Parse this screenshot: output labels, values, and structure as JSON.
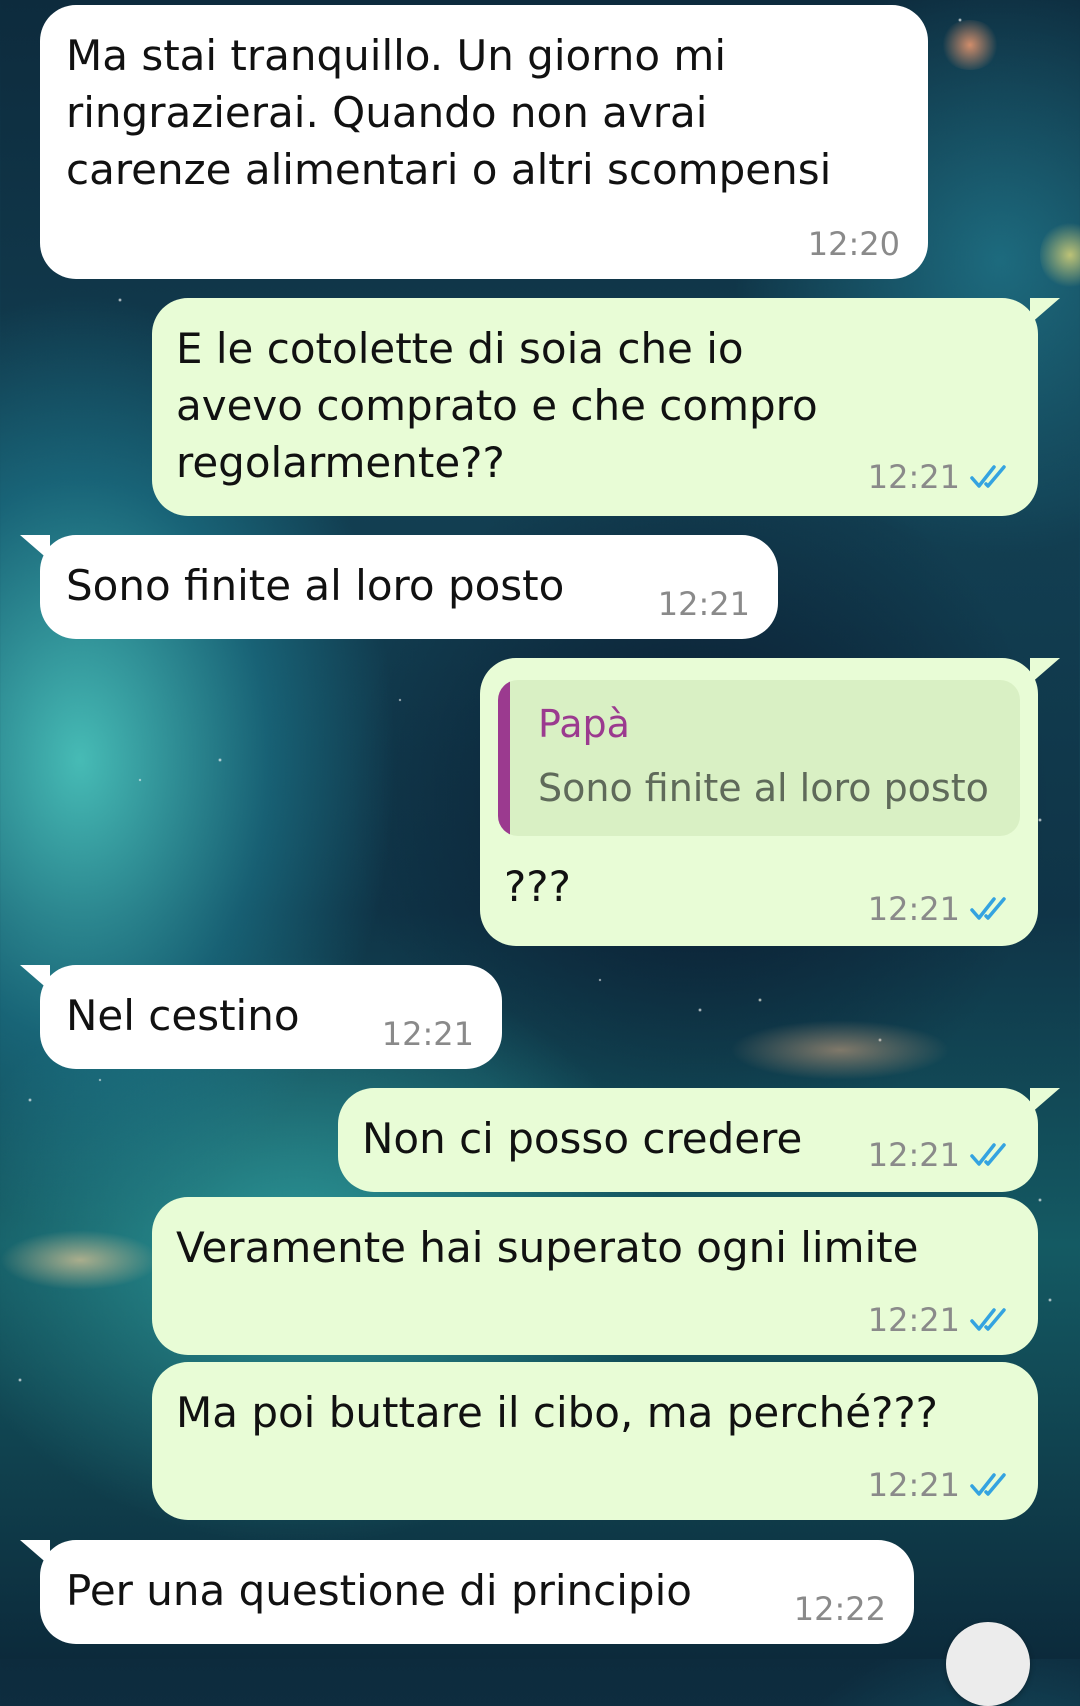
{
  "chat": {
    "messages": [
      {
        "direction": "incoming",
        "text": "Ma stai tranquillo. Un giorno mi\nringrazierai. Quando non avrai\ncarenze alimentari o altri scompensi",
        "time": "12:20"
      },
      {
        "direction": "outgoing",
        "text": "E le cotolette di soia che io\navevo comprato e che compro\nregolarmente??",
        "time": "12:21",
        "status": "read"
      },
      {
        "direction": "incoming",
        "text": "Sono finite al loro posto",
        "time": "12:21"
      },
      {
        "direction": "outgoing",
        "quote": {
          "author": "Papà",
          "text": "Sono finite al loro posto"
        },
        "text": "???",
        "time": "12:21",
        "status": "read"
      },
      {
        "direction": "incoming",
        "text": "Nel cestino",
        "time": "12:21"
      },
      {
        "direction": "outgoing",
        "text": "Non ci posso credere",
        "time": "12:21",
        "status": "read"
      },
      {
        "direction": "outgoing",
        "text": "Veramente hai superato ogni limite",
        "time": "12:21",
        "status": "read"
      },
      {
        "direction": "outgoing",
        "text": "Ma poi buttare il cibo, ma perché???",
        "time": "12:21",
        "status": "read"
      },
      {
        "direction": "incoming",
        "text": "Per una questione di principio",
        "time": "12:22"
      }
    ]
  },
  "colors": {
    "incoming_bubble": "#ffffff",
    "outgoing_bubble": "#e8fcd6",
    "read_check": "#34a3e0",
    "quote_accent": "#9b3a8f"
  },
  "icons": {
    "read_receipt": "double-check-icon"
  }
}
